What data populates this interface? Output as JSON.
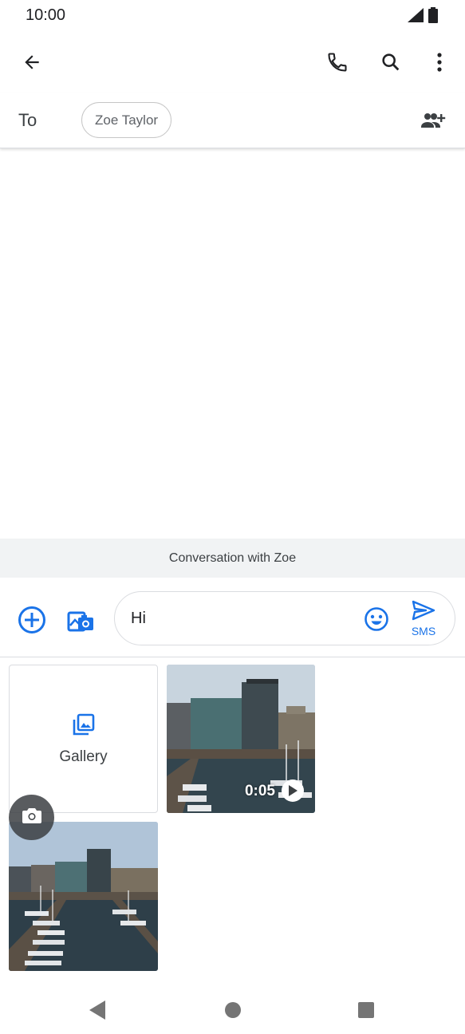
{
  "status_bar": {
    "time": "10:00",
    "icons": [
      "signal-icon",
      "battery-icon"
    ]
  },
  "app_bar": {
    "icons": [
      "back-arrow-icon",
      "phone-icon",
      "search-icon",
      "more-vert-icon"
    ]
  },
  "recipient": {
    "to_label": "To",
    "chip_name": "Zoe Taylor",
    "add_icon": "add-contact-icon"
  },
  "conversation": {
    "label": "Conversation with Zoe"
  },
  "compose": {
    "text": "Hi",
    "send_label": "SMS",
    "icons": [
      "add-circle-icon",
      "gallery-camera-icon",
      "emoji-icon",
      "send-icon"
    ]
  },
  "media": {
    "gallery_label": "Gallery",
    "video_duration": "0:05",
    "icons": [
      "gallery-icon",
      "play-icon",
      "camera-icon"
    ]
  },
  "nav_bar": {
    "icons": [
      "nav-back-icon",
      "nav-home-icon",
      "nav-recents-icon"
    ]
  },
  "colors": {
    "accent": "#1a73e8",
    "text": "#202124",
    "muted": "#5f6368",
    "conversation_bar": "#f1f3f4"
  }
}
